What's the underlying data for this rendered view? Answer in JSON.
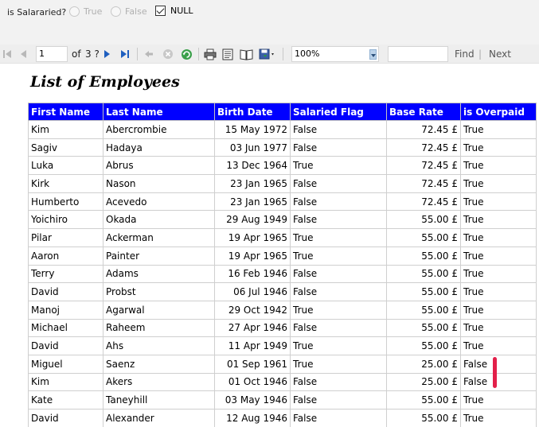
{
  "parameters": {
    "label": "is Salararied?",
    "options": [
      {
        "label": "True",
        "selected": false
      },
      {
        "label": "False",
        "selected": false
      }
    ],
    "null_checkbox": {
      "label": "NULL",
      "checked": true
    }
  },
  "toolbar": {
    "current_page": "1",
    "page_of": "of",
    "total_pages": "3 ?",
    "zoom": "100%",
    "find_label": "Find",
    "separator": "|",
    "next_label": "Next"
  },
  "report": {
    "title": "List of Employees",
    "columns": [
      "First Name",
      "Last Name",
      "Birth Date",
      "Salaried Flag",
      "Base Rate",
      "is Overpaid"
    ],
    "rows": [
      [
        "Kim",
        "Abercrombie",
        "15 May 1972",
        "False",
        "72.45 £",
        "True"
      ],
      [
        "Sagiv",
        "Hadaya",
        "03 Jun 1977",
        "False",
        "72.45 £",
        "True"
      ],
      [
        "Luka",
        "Abrus",
        "13 Dec 1964",
        "True",
        "72.45 £",
        "True"
      ],
      [
        "Kirk",
        "Nason",
        "23 Jan 1965",
        "False",
        "72.45 £",
        "True"
      ],
      [
        "Humberto",
        "Acevedo",
        "23 Jan 1965",
        "False",
        "72.45 £",
        "True"
      ],
      [
        "Yoichiro",
        "Okada",
        "29 Aug 1949",
        "False",
        "55.00 £",
        "True"
      ],
      [
        "Pilar",
        "Ackerman",
        "19 Apr 1965",
        "True",
        "55.00 £",
        "True"
      ],
      [
        "Aaron",
        "Painter",
        "19 Apr 1965",
        "True",
        "55.00 £",
        "True"
      ],
      [
        "Terry",
        "Adams",
        "16 Feb 1946",
        "False",
        "55.00 £",
        "True"
      ],
      [
        "David",
        "Probst",
        "06 Jul 1946",
        "False",
        "55.00 £",
        "True"
      ],
      [
        "Manoj",
        "Agarwal",
        "29 Oct 1942",
        "True",
        "55.00 £",
        "True"
      ],
      [
        "Michael",
        "Raheem",
        "27 Apr 1946",
        "False",
        "55.00 £",
        "True"
      ],
      [
        "David",
        "Ahs",
        "11 Apr 1949",
        "True",
        "55.00 £",
        "True"
      ],
      [
        "Miguel",
        "Saenz",
        "01 Sep 1961",
        "True",
        "25.00 £",
        "False"
      ],
      [
        "Kim",
        "Akers",
        "01 Oct 1946",
        "False",
        "25.00 £",
        "False"
      ],
      [
        "Kate",
        "Taneyhill",
        "03 May 1946",
        "False",
        "55.00 £",
        "True"
      ],
      [
        "David",
        "Alexander",
        "12 Aug 1946",
        "False",
        "55.00 £",
        "True"
      ]
    ]
  },
  "colors": {
    "header_bg": "#0000ff",
    "header_text": "#ffffff",
    "highlight_mark": "#e3204a"
  }
}
